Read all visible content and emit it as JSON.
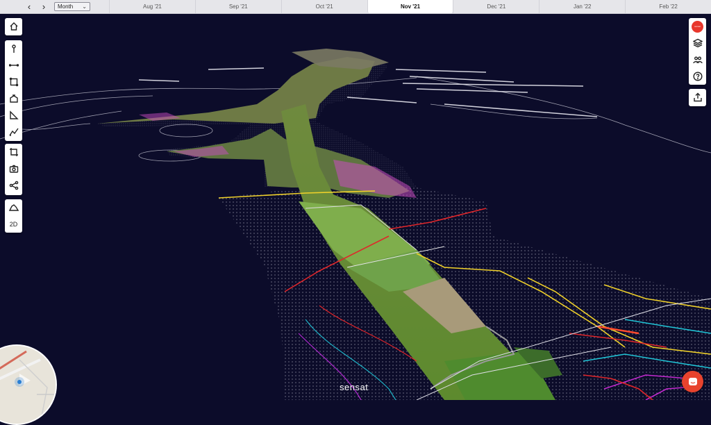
{
  "timeline": {
    "period": "Month",
    "months": [
      "Aug '21",
      "Sep '21",
      "Oct '21",
      "Nov '21",
      "Dec '21",
      "Jan '22",
      "Feb '22"
    ],
    "active_month": "Nov '21"
  },
  "tools": {
    "view_2d_label": "2D"
  },
  "brand": {
    "watermark": "sensat",
    "badge": "sensat",
    "accent_color": "#e8372c"
  },
  "scene": {
    "background_color": "#0c0c2a"
  }
}
